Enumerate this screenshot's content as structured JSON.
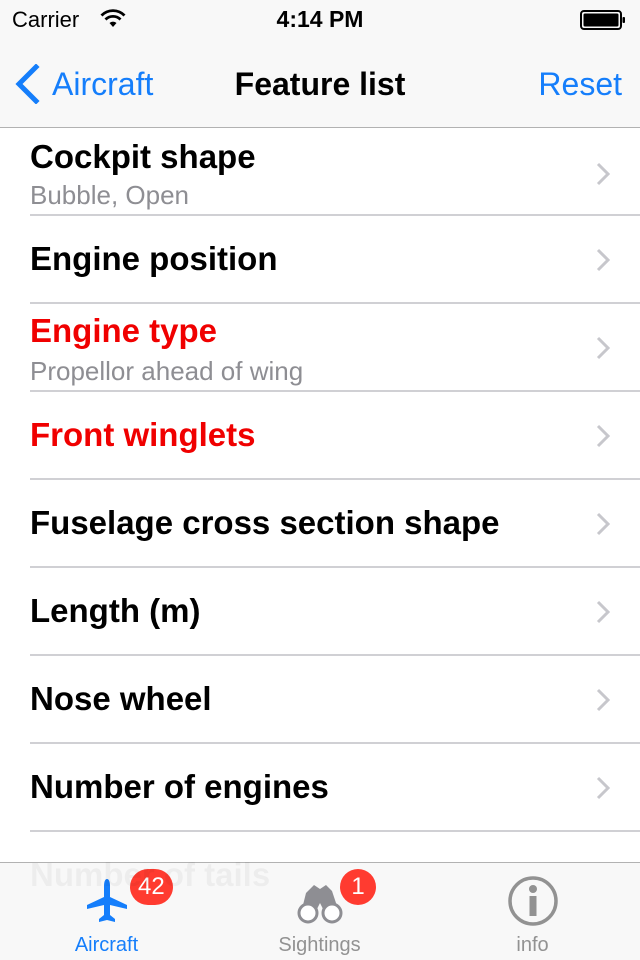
{
  "status_bar": {
    "carrier": "Carrier",
    "time": "4:14 PM",
    "wifi_icon": "wifi-icon",
    "battery_icon": "battery-full-icon"
  },
  "nav_bar": {
    "back_label": "Aircraft",
    "title": "Feature list",
    "reset_label": "Reset",
    "tint_color": "#157efb"
  },
  "features": [
    {
      "title": "Cockpit shape",
      "subtitle": "Bubble, Open",
      "highlighted": false
    },
    {
      "title": "Engine position",
      "subtitle": "",
      "highlighted": false
    },
    {
      "title": "Engine type",
      "subtitle": "Propellor ahead of wing",
      "highlighted": true
    },
    {
      "title": "Front winglets",
      "subtitle": "",
      "highlighted": true
    },
    {
      "title": "Fuselage cross section shape",
      "subtitle": "",
      "highlighted": false
    },
    {
      "title": "Length (m)",
      "subtitle": "",
      "highlighted": false
    },
    {
      "title": "Nose wheel",
      "subtitle": "",
      "highlighted": false
    },
    {
      "title": "Number of engines",
      "subtitle": "",
      "highlighted": false
    }
  ],
  "obscured_rows": [
    "Number of tails"
  ],
  "colors": {
    "highlight": "#f00000",
    "badge": "#ff3b30",
    "inactive_tab": "#929292"
  },
  "tab_bar": {
    "tabs": [
      {
        "label": "Aircraft",
        "icon": "airplane-icon",
        "badge": "42",
        "active": true
      },
      {
        "label": "Sightings",
        "icon": "binoculars-icon",
        "badge": "1",
        "active": false
      },
      {
        "label": "info",
        "icon": "info-icon",
        "badge": "",
        "active": false
      }
    ]
  }
}
